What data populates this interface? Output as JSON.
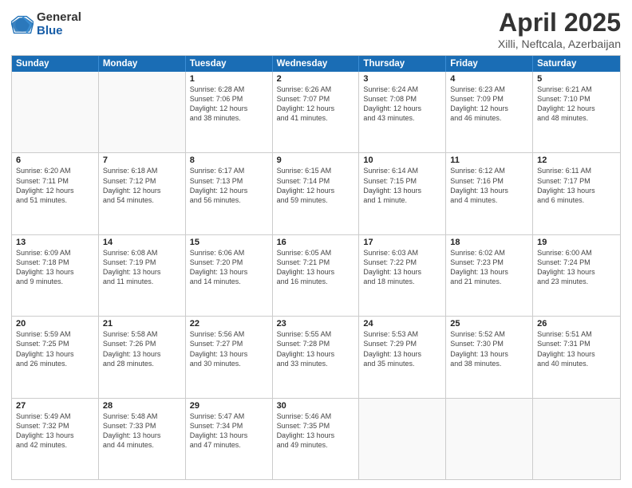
{
  "logo": {
    "general": "General",
    "blue": "Blue"
  },
  "title": {
    "month_year": "April 2025",
    "location": "Xilli, Neftcala, Azerbaijan"
  },
  "header_days": [
    "Sunday",
    "Monday",
    "Tuesday",
    "Wednesday",
    "Thursday",
    "Friday",
    "Saturday"
  ],
  "weeks": [
    [
      {
        "day": "",
        "info": ""
      },
      {
        "day": "",
        "info": ""
      },
      {
        "day": "1",
        "info": "Sunrise: 6:28 AM\nSunset: 7:06 PM\nDaylight: 12 hours\nand 38 minutes."
      },
      {
        "day": "2",
        "info": "Sunrise: 6:26 AM\nSunset: 7:07 PM\nDaylight: 12 hours\nand 41 minutes."
      },
      {
        "day": "3",
        "info": "Sunrise: 6:24 AM\nSunset: 7:08 PM\nDaylight: 12 hours\nand 43 minutes."
      },
      {
        "day": "4",
        "info": "Sunrise: 6:23 AM\nSunset: 7:09 PM\nDaylight: 12 hours\nand 46 minutes."
      },
      {
        "day": "5",
        "info": "Sunrise: 6:21 AM\nSunset: 7:10 PM\nDaylight: 12 hours\nand 48 minutes."
      }
    ],
    [
      {
        "day": "6",
        "info": "Sunrise: 6:20 AM\nSunset: 7:11 PM\nDaylight: 12 hours\nand 51 minutes."
      },
      {
        "day": "7",
        "info": "Sunrise: 6:18 AM\nSunset: 7:12 PM\nDaylight: 12 hours\nand 54 minutes."
      },
      {
        "day": "8",
        "info": "Sunrise: 6:17 AM\nSunset: 7:13 PM\nDaylight: 12 hours\nand 56 minutes."
      },
      {
        "day": "9",
        "info": "Sunrise: 6:15 AM\nSunset: 7:14 PM\nDaylight: 12 hours\nand 59 minutes."
      },
      {
        "day": "10",
        "info": "Sunrise: 6:14 AM\nSunset: 7:15 PM\nDaylight: 13 hours\nand 1 minute."
      },
      {
        "day": "11",
        "info": "Sunrise: 6:12 AM\nSunset: 7:16 PM\nDaylight: 13 hours\nand 4 minutes."
      },
      {
        "day": "12",
        "info": "Sunrise: 6:11 AM\nSunset: 7:17 PM\nDaylight: 13 hours\nand 6 minutes."
      }
    ],
    [
      {
        "day": "13",
        "info": "Sunrise: 6:09 AM\nSunset: 7:18 PM\nDaylight: 13 hours\nand 9 minutes."
      },
      {
        "day": "14",
        "info": "Sunrise: 6:08 AM\nSunset: 7:19 PM\nDaylight: 13 hours\nand 11 minutes."
      },
      {
        "day": "15",
        "info": "Sunrise: 6:06 AM\nSunset: 7:20 PM\nDaylight: 13 hours\nand 14 minutes."
      },
      {
        "day": "16",
        "info": "Sunrise: 6:05 AM\nSunset: 7:21 PM\nDaylight: 13 hours\nand 16 minutes."
      },
      {
        "day": "17",
        "info": "Sunrise: 6:03 AM\nSunset: 7:22 PM\nDaylight: 13 hours\nand 18 minutes."
      },
      {
        "day": "18",
        "info": "Sunrise: 6:02 AM\nSunset: 7:23 PM\nDaylight: 13 hours\nand 21 minutes."
      },
      {
        "day": "19",
        "info": "Sunrise: 6:00 AM\nSunset: 7:24 PM\nDaylight: 13 hours\nand 23 minutes."
      }
    ],
    [
      {
        "day": "20",
        "info": "Sunrise: 5:59 AM\nSunset: 7:25 PM\nDaylight: 13 hours\nand 26 minutes."
      },
      {
        "day": "21",
        "info": "Sunrise: 5:58 AM\nSunset: 7:26 PM\nDaylight: 13 hours\nand 28 minutes."
      },
      {
        "day": "22",
        "info": "Sunrise: 5:56 AM\nSunset: 7:27 PM\nDaylight: 13 hours\nand 30 minutes."
      },
      {
        "day": "23",
        "info": "Sunrise: 5:55 AM\nSunset: 7:28 PM\nDaylight: 13 hours\nand 33 minutes."
      },
      {
        "day": "24",
        "info": "Sunrise: 5:53 AM\nSunset: 7:29 PM\nDaylight: 13 hours\nand 35 minutes."
      },
      {
        "day": "25",
        "info": "Sunrise: 5:52 AM\nSunset: 7:30 PM\nDaylight: 13 hours\nand 38 minutes."
      },
      {
        "day": "26",
        "info": "Sunrise: 5:51 AM\nSunset: 7:31 PM\nDaylight: 13 hours\nand 40 minutes."
      }
    ],
    [
      {
        "day": "27",
        "info": "Sunrise: 5:49 AM\nSunset: 7:32 PM\nDaylight: 13 hours\nand 42 minutes."
      },
      {
        "day": "28",
        "info": "Sunrise: 5:48 AM\nSunset: 7:33 PM\nDaylight: 13 hours\nand 44 minutes."
      },
      {
        "day": "29",
        "info": "Sunrise: 5:47 AM\nSunset: 7:34 PM\nDaylight: 13 hours\nand 47 minutes."
      },
      {
        "day": "30",
        "info": "Sunrise: 5:46 AM\nSunset: 7:35 PM\nDaylight: 13 hours\nand 49 minutes."
      },
      {
        "day": "",
        "info": ""
      },
      {
        "day": "",
        "info": ""
      },
      {
        "day": "",
        "info": ""
      }
    ]
  ]
}
